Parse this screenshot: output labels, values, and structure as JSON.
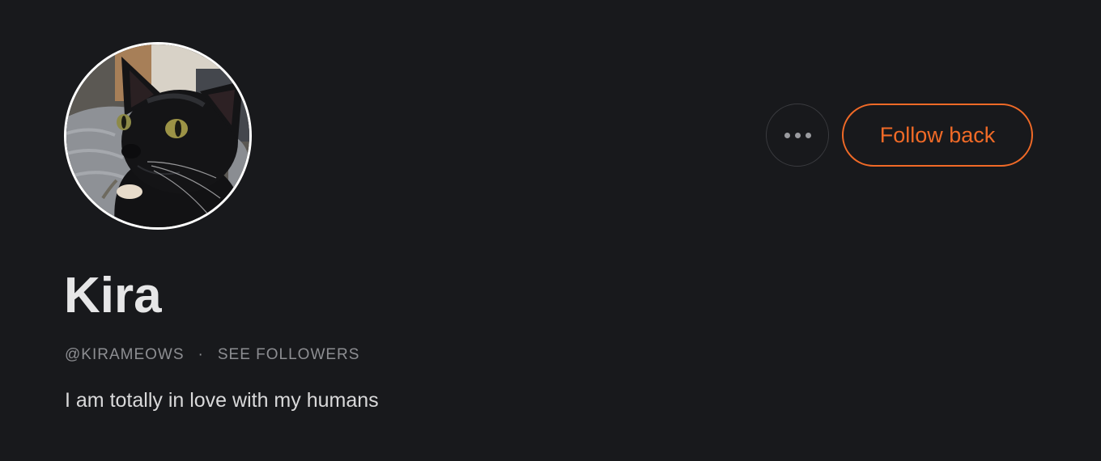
{
  "profile": {
    "display_name": "Kira",
    "handle": "@KIRAMEOWS",
    "separator": "·",
    "followers_link": "SEE FOLLOWERS",
    "bio": "I am totally in love with my humans",
    "avatar_icon": "black-cat-photo"
  },
  "actions": {
    "more_icon": "ellipsis-icon",
    "follow_label": "Follow back"
  },
  "colors": {
    "background": "#18191c",
    "accent": "#f06a27",
    "muted": "#8d8e92"
  }
}
